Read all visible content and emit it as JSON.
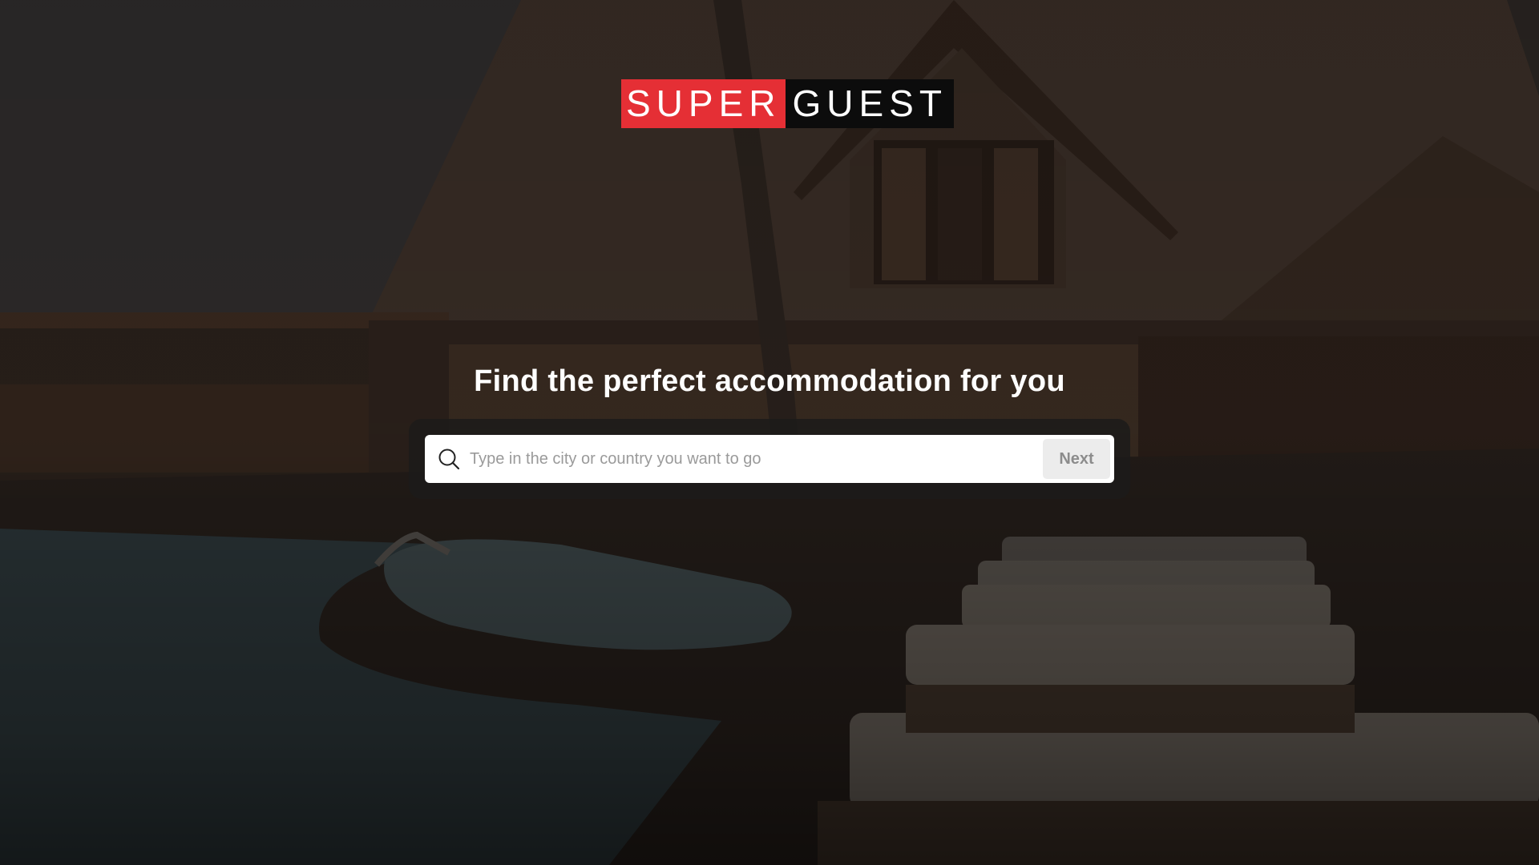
{
  "brand": {
    "logo_part1": "SUPER",
    "logo_part2": "GUEST",
    "accent_color": "#e52f35"
  },
  "hero": {
    "headline": "Find the perfect accommodation for you",
    "background_description_icon": "resort-photo"
  },
  "search": {
    "placeholder": "Type in the city or country you want to go",
    "value": "",
    "icon": "search-icon",
    "next_label": "Next"
  }
}
